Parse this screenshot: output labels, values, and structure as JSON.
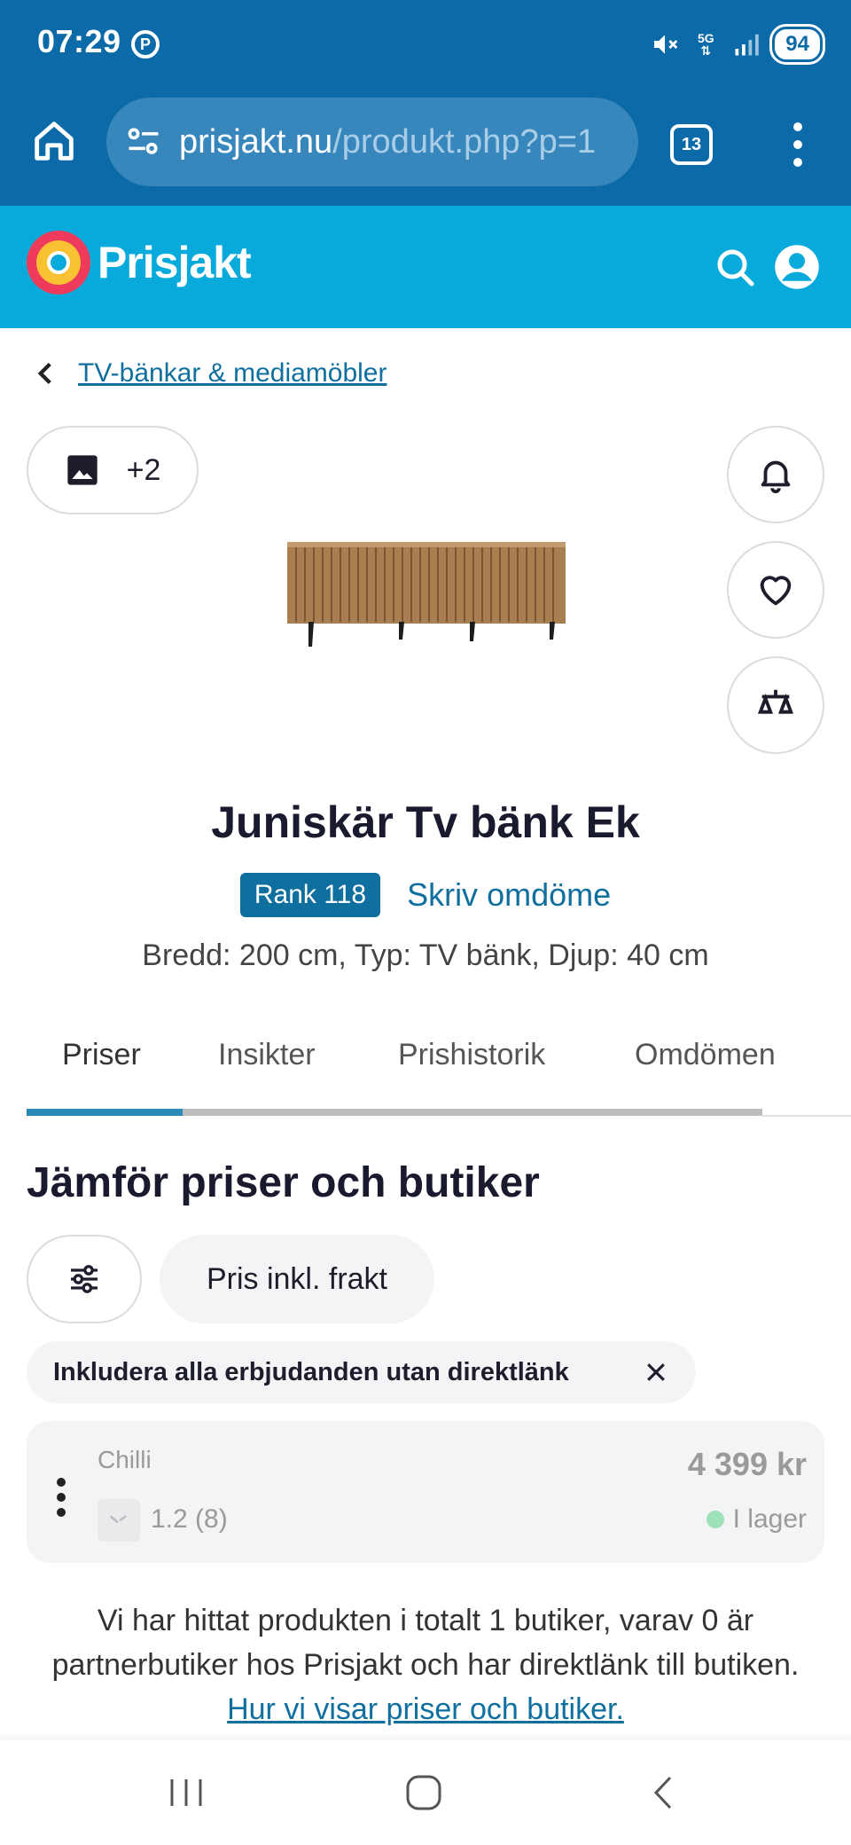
{
  "status_bar": {
    "time": "07:29",
    "network": "5G",
    "battery": "94"
  },
  "browser": {
    "url_domain": "prisjakt.nu",
    "url_path": "/produkt.php?p=1",
    "tab_count": "13"
  },
  "site": {
    "logo_text": "Prisjakt",
    "brand_color": "#07aadb"
  },
  "breadcrumb": {
    "label": "TV-bänkar & mediamöbler"
  },
  "gallery": {
    "extra_images": "+2"
  },
  "product": {
    "title": "Juniskär Tv bänk Ek",
    "rank": "Rank 118",
    "review_link": "Skriv omdöme",
    "specs": "Bredd: 200 cm, Typ: TV bänk, Djup: 40 cm"
  },
  "tabs": [
    {
      "label": "Priser"
    },
    {
      "label": "Insikter"
    },
    {
      "label": "Prishistorik"
    },
    {
      "label": "Omdömen"
    }
  ],
  "compare": {
    "title": "Jämför priser och butiker",
    "shipping_chip": "Pris inkl. frakt",
    "offers_chip": "Inkludera alla erbjudanden utan direktlänk"
  },
  "store": {
    "name": "Chilli",
    "price": "4 399 kr",
    "rating": "1.2 (8)",
    "stock": "I lager"
  },
  "info": {
    "text": "Vi har hittat produkten i totalt 1 butiker, varav 0 är partnerbutiker hos Prisjakt och har direktlänk till butiken.",
    "link": "Hur vi visar priser och butiker."
  }
}
